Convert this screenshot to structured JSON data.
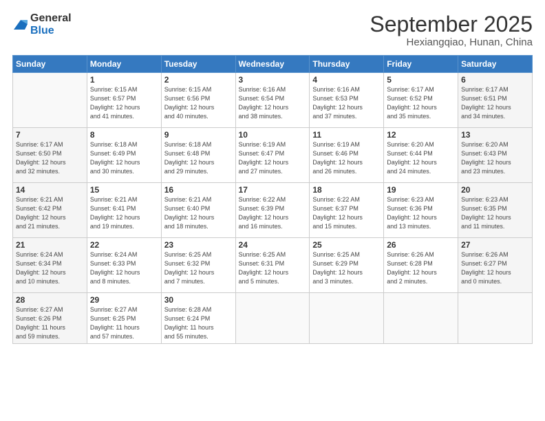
{
  "logo": {
    "general": "General",
    "blue": "Blue"
  },
  "header": {
    "title": "September 2025",
    "subtitle": "Hexiangqiao, Hunan, China"
  },
  "weekdays": [
    "Sunday",
    "Monday",
    "Tuesday",
    "Wednesday",
    "Thursday",
    "Friday",
    "Saturday"
  ],
  "weeks": [
    [
      {
        "day": "",
        "info": ""
      },
      {
        "day": "1",
        "info": "Sunrise: 6:15 AM\nSunset: 6:57 PM\nDaylight: 12 hours\nand 41 minutes."
      },
      {
        "day": "2",
        "info": "Sunrise: 6:15 AM\nSunset: 6:56 PM\nDaylight: 12 hours\nand 40 minutes."
      },
      {
        "day": "3",
        "info": "Sunrise: 6:16 AM\nSunset: 6:54 PM\nDaylight: 12 hours\nand 38 minutes."
      },
      {
        "day": "4",
        "info": "Sunrise: 6:16 AM\nSunset: 6:53 PM\nDaylight: 12 hours\nand 37 minutes."
      },
      {
        "day": "5",
        "info": "Sunrise: 6:17 AM\nSunset: 6:52 PM\nDaylight: 12 hours\nand 35 minutes."
      },
      {
        "day": "6",
        "info": "Sunrise: 6:17 AM\nSunset: 6:51 PM\nDaylight: 12 hours\nand 34 minutes."
      }
    ],
    [
      {
        "day": "7",
        "info": "Sunrise: 6:17 AM\nSunset: 6:50 PM\nDaylight: 12 hours\nand 32 minutes."
      },
      {
        "day": "8",
        "info": "Sunrise: 6:18 AM\nSunset: 6:49 PM\nDaylight: 12 hours\nand 30 minutes."
      },
      {
        "day": "9",
        "info": "Sunrise: 6:18 AM\nSunset: 6:48 PM\nDaylight: 12 hours\nand 29 minutes."
      },
      {
        "day": "10",
        "info": "Sunrise: 6:19 AM\nSunset: 6:47 PM\nDaylight: 12 hours\nand 27 minutes."
      },
      {
        "day": "11",
        "info": "Sunrise: 6:19 AM\nSunset: 6:46 PM\nDaylight: 12 hours\nand 26 minutes."
      },
      {
        "day": "12",
        "info": "Sunrise: 6:20 AM\nSunset: 6:44 PM\nDaylight: 12 hours\nand 24 minutes."
      },
      {
        "day": "13",
        "info": "Sunrise: 6:20 AM\nSunset: 6:43 PM\nDaylight: 12 hours\nand 23 minutes."
      }
    ],
    [
      {
        "day": "14",
        "info": "Sunrise: 6:21 AM\nSunset: 6:42 PM\nDaylight: 12 hours\nand 21 minutes."
      },
      {
        "day": "15",
        "info": "Sunrise: 6:21 AM\nSunset: 6:41 PM\nDaylight: 12 hours\nand 19 minutes."
      },
      {
        "day": "16",
        "info": "Sunrise: 6:21 AM\nSunset: 6:40 PM\nDaylight: 12 hours\nand 18 minutes."
      },
      {
        "day": "17",
        "info": "Sunrise: 6:22 AM\nSunset: 6:39 PM\nDaylight: 12 hours\nand 16 minutes."
      },
      {
        "day": "18",
        "info": "Sunrise: 6:22 AM\nSunset: 6:37 PM\nDaylight: 12 hours\nand 15 minutes."
      },
      {
        "day": "19",
        "info": "Sunrise: 6:23 AM\nSunset: 6:36 PM\nDaylight: 12 hours\nand 13 minutes."
      },
      {
        "day": "20",
        "info": "Sunrise: 6:23 AM\nSunset: 6:35 PM\nDaylight: 12 hours\nand 11 minutes."
      }
    ],
    [
      {
        "day": "21",
        "info": "Sunrise: 6:24 AM\nSunset: 6:34 PM\nDaylight: 12 hours\nand 10 minutes."
      },
      {
        "day": "22",
        "info": "Sunrise: 6:24 AM\nSunset: 6:33 PM\nDaylight: 12 hours\nand 8 minutes."
      },
      {
        "day": "23",
        "info": "Sunrise: 6:25 AM\nSunset: 6:32 PM\nDaylight: 12 hours\nand 7 minutes."
      },
      {
        "day": "24",
        "info": "Sunrise: 6:25 AM\nSunset: 6:31 PM\nDaylight: 12 hours\nand 5 minutes."
      },
      {
        "day": "25",
        "info": "Sunrise: 6:25 AM\nSunset: 6:29 PM\nDaylight: 12 hours\nand 3 minutes."
      },
      {
        "day": "26",
        "info": "Sunrise: 6:26 AM\nSunset: 6:28 PM\nDaylight: 12 hours\nand 2 minutes."
      },
      {
        "day": "27",
        "info": "Sunrise: 6:26 AM\nSunset: 6:27 PM\nDaylight: 12 hours\nand 0 minutes."
      }
    ],
    [
      {
        "day": "28",
        "info": "Sunrise: 6:27 AM\nSunset: 6:26 PM\nDaylight: 11 hours\nand 59 minutes."
      },
      {
        "day": "29",
        "info": "Sunrise: 6:27 AM\nSunset: 6:25 PM\nDaylight: 11 hours\nand 57 minutes."
      },
      {
        "day": "30",
        "info": "Sunrise: 6:28 AM\nSunset: 6:24 PM\nDaylight: 11 hours\nand 55 minutes."
      },
      {
        "day": "",
        "info": ""
      },
      {
        "day": "",
        "info": ""
      },
      {
        "day": "",
        "info": ""
      },
      {
        "day": "",
        "info": ""
      }
    ]
  ]
}
